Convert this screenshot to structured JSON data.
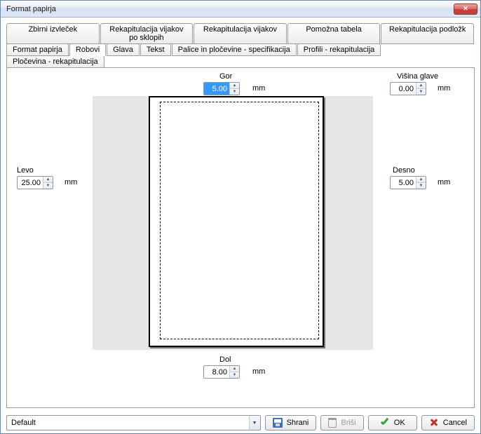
{
  "window": {
    "title": "Format papirja"
  },
  "tabs_row1": [
    {
      "label": "Zbirni izvleček"
    },
    {
      "label": "Rekapitulacija vijakov po sklopih"
    },
    {
      "label": "Rekapitulacija vijakov"
    },
    {
      "label": "Pomožna tabela"
    },
    {
      "label": "Rekapitulacija podložk"
    }
  ],
  "tabs_row2": [
    {
      "label": "Format papirja"
    },
    {
      "label": "Robovi",
      "active": true
    },
    {
      "label": "Glava"
    },
    {
      "label": "Tekst"
    },
    {
      "label": "Palice in pločevine - specifikacija"
    },
    {
      "label": "Profili - rekapitulacija"
    },
    {
      "label": "Pločevina - rekapitulacija"
    }
  ],
  "margins": {
    "top": {
      "label": "Gor",
      "value": "5.00",
      "unit": "mm"
    },
    "bottom": {
      "label": "Dol",
      "value": "8.00",
      "unit": "mm"
    },
    "left": {
      "label": "Levo",
      "value": "25.00",
      "unit": "mm"
    },
    "right": {
      "label": "Desno",
      "value": "5.00",
      "unit": "mm"
    }
  },
  "head_height": {
    "label": "Višina glave",
    "value": "0.00",
    "unit": "mm"
  },
  "footer": {
    "profile": "Default",
    "save": "Shrani",
    "delete": "Briši",
    "ok": "OK",
    "cancel": "Cancel"
  }
}
